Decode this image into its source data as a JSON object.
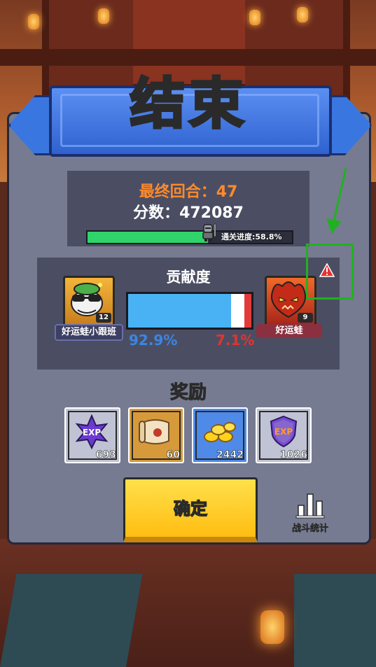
{
  "title": "结束",
  "summary": {
    "round_label": "最终回合：47",
    "score_label": "分数：472087",
    "progress": {
      "value": 0.588,
      "label": "通关进度:58.8%"
    }
  },
  "contribution": {
    "title": "贡献度",
    "ally": {
      "name": "好运蛙小跟班",
      "level": "12",
      "percent_label": "92.9%",
      "percent": 92.9
    },
    "enemy": {
      "name": "好运蛙",
      "level": "9",
      "percent_label": "7.1%",
      "percent": 7.1
    }
  },
  "rewards": {
    "title": "奖励",
    "items": [
      {
        "icon": "exp-star-icon",
        "text": "EXP",
        "value": "693"
      },
      {
        "icon": "scroll-icon",
        "value": "60"
      },
      {
        "icon": "gold-coins-icon",
        "value": "2442"
      },
      {
        "icon": "exp-shield-icon",
        "text": "EXP",
        "value": "1026"
      }
    ]
  },
  "buttons": {
    "confirm": "确定",
    "battle_stats": "战斗统计"
  },
  "colors": {
    "round_orange": "#ff8a2a",
    "progress_green": "#2fd46a",
    "ally_blue": "#49b2f5",
    "enemy_red": "#e23a3a",
    "confirm_yellow": "#ffd21e",
    "annotation_green": "#22b022"
  }
}
